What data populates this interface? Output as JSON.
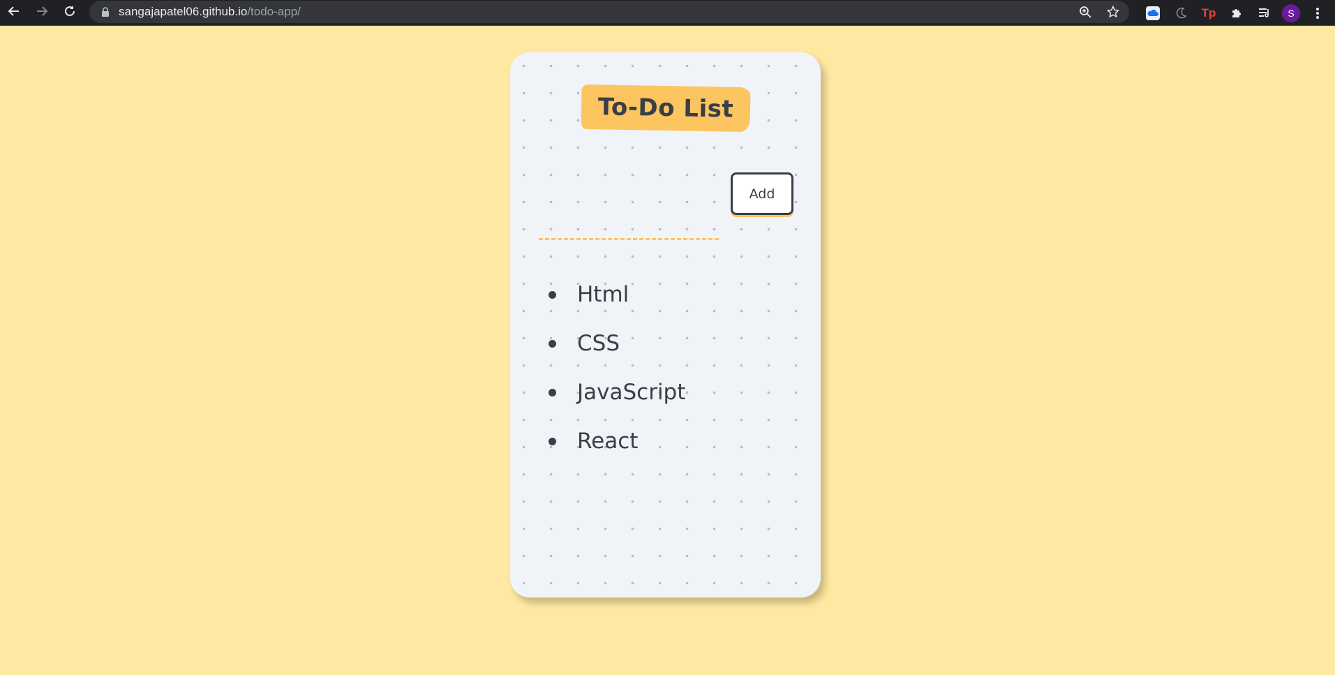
{
  "browser": {
    "url_host": "sangajapatel06.github.io",
    "url_path": "/todo-app/",
    "avatar_letter": "S"
  },
  "app": {
    "title": "To-Do List",
    "add_label": "Add",
    "input_value": "",
    "items": [
      "Html",
      "CSS",
      "JavaScript",
      "React"
    ]
  },
  "colors": {
    "page_bg": "#ffe8a1",
    "card_bg": "#f0f4f8",
    "accent": "#fcc560",
    "text": "#3b3e45"
  }
}
